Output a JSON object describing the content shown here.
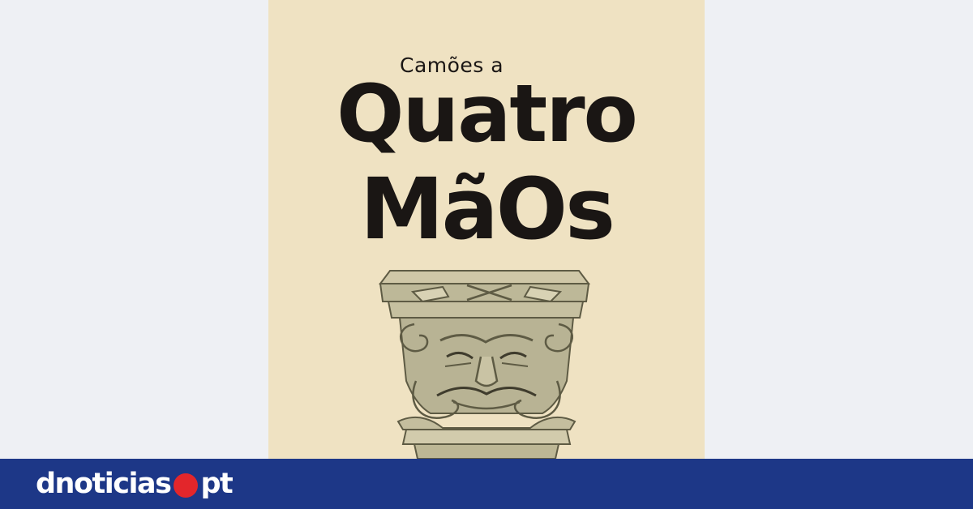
{
  "poster": {
    "subtitle": "Camões a",
    "title_line1": "Quatro",
    "title_line2": "MãOs",
    "background_color": "#efe2c2",
    "text_color": "#1a1614",
    "illustration": "carved-stone-capital-with-grimacing-face"
  },
  "footer": {
    "logo_left": "dnoticias",
    "logo_right": "pt",
    "bar_color": "#1d3787",
    "dot_color": "#e3262b"
  },
  "page": {
    "background_color": "#eef0f4"
  }
}
